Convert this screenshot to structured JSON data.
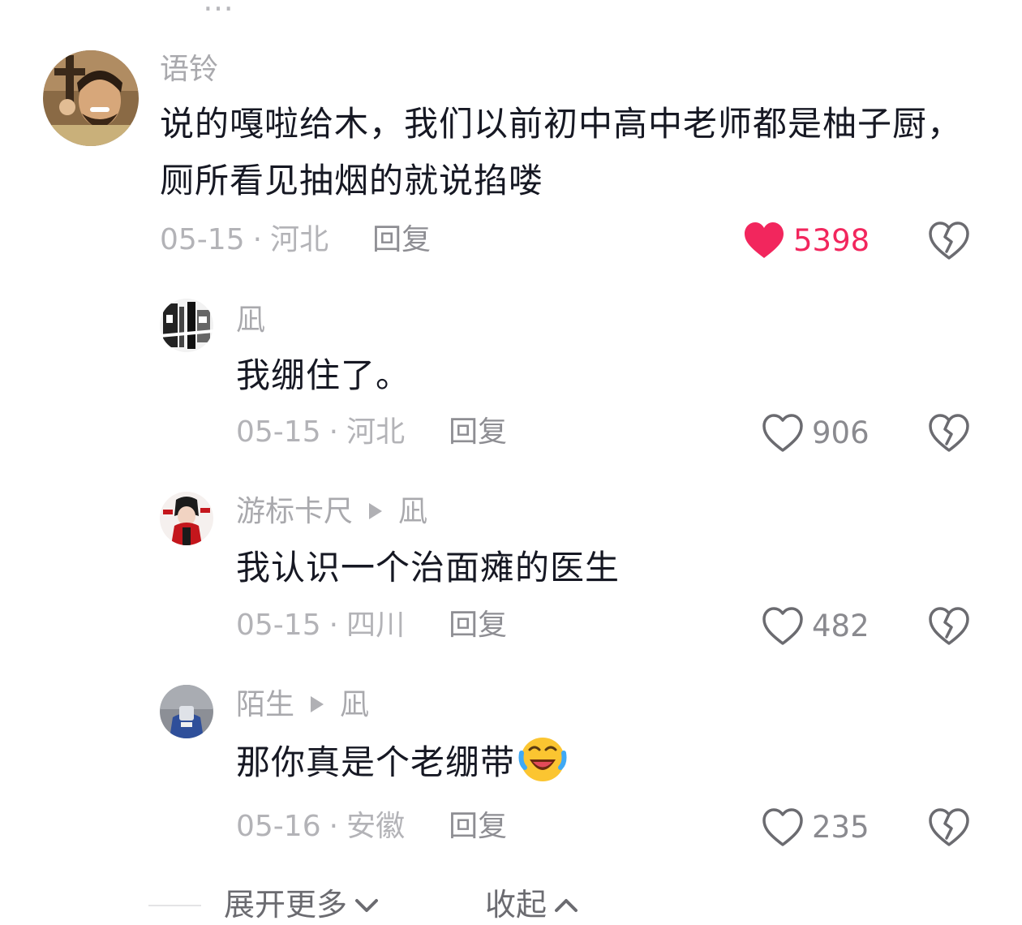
{
  "truncated_previous": "…",
  "comments": [
    {
      "username": "语铃",
      "reply_to": "",
      "text": "说的嘎啦给木，我们以前初中高中老师都是柚子厨，厕所看见抽烟的就说掐喽",
      "date": "05-15",
      "location": "河北",
      "reply_label": "回复",
      "likes": "5398",
      "liked": true,
      "avatar_icon": "avatar-photo-smiling-man"
    },
    {
      "username": "凪",
      "reply_to": "",
      "text": "我绷住了。",
      "date": "05-15",
      "location": "河北",
      "reply_label": "回复",
      "likes": "906",
      "liked": false,
      "avatar_icon": "avatar-manga-illustration"
    },
    {
      "username": "游标卡尺",
      "reply_to": "凪",
      "text": "我认识一个治面瘫的医生",
      "date": "05-15",
      "location": "四川",
      "reply_label": "回复",
      "likes": "482",
      "liked": false,
      "avatar_icon": "avatar-anime-character-red"
    },
    {
      "username": "陌生",
      "reply_to": "凪",
      "text": "那你真是个老绷带",
      "date": "05-16",
      "location": "安徽",
      "reply_label": "回复",
      "likes": "235",
      "liked": false,
      "avatar_icon": "avatar-blue-figure"
    }
  ],
  "emoji": "rolling-laughing-emoji",
  "footer": {
    "expand_more": "展开更多",
    "collapse": "收起"
  },
  "colors": {
    "liked_heart": "#f2265d",
    "muted_text": "#b3b3b7",
    "body_text": "#161823"
  }
}
